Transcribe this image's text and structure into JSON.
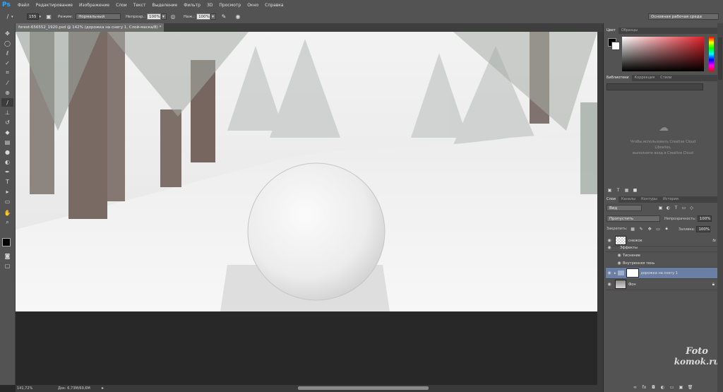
{
  "app": {
    "logo": "Ps"
  },
  "menu": [
    "Файл",
    "Редактирование",
    "Изображение",
    "Слои",
    "Текст",
    "Выделение",
    "Фильтр",
    "3D",
    "Просмотр",
    "Окно",
    "Справка"
  ],
  "options": {
    "size": "155",
    "mode_label": "Режим:",
    "mode_value": "Нормальный",
    "opacity_label": "Непрозр.:",
    "opacity_value": "100%",
    "pressure_label": "Наж.:",
    "pressure_value": "100%",
    "workspace": "Основная рабочая среда"
  },
  "document": {
    "tab_title": "forest-656552_1920.psd @ 142% (дорожка на снегу 1, Слой-маска/8) *",
    "zoom": "141,72%",
    "doc_size": "Док: 6,73M/69,6M"
  },
  "tools": [
    "move-icon",
    "marquee-icon",
    "lasso-icon",
    "quick-select-icon",
    "crop-icon",
    "eyedropper-icon",
    "heal-icon",
    "brush-icon",
    "stamp-icon",
    "history-brush-icon",
    "eraser-icon",
    "gradient-icon",
    "blur-icon",
    "dodge-icon",
    "pen-icon",
    "type-icon",
    "path-select-icon",
    "shape-icon",
    "hand-icon",
    "zoom-icon"
  ],
  "color_panel": {
    "tabs": [
      "Цвет",
      "Образцы"
    ]
  },
  "libraries_panel": {
    "tabs": [
      "Библиотеки",
      "Коррекция",
      "Стили"
    ],
    "message_line1": "Чтобы использовать Creative Cloud",
    "message_line2": "Libraries,",
    "message_line3": "выполните вход в Creative Cloud"
  },
  "layers_panel": {
    "tabs": [
      "Слои",
      "Каналы",
      "Контуры",
      "История"
    ],
    "kind_filter": "Вид",
    "blend_mode": "Пропустить",
    "opacity_label": "Непрозрачность:",
    "opacity_value": "100%",
    "lock_label": "Закрепить:",
    "fill_label": "Заливка:",
    "fill_value": "100%",
    "layers": [
      {
        "name": "снежок",
        "fx": "fx"
      },
      {
        "name": "Эффекты"
      },
      {
        "name": "Тиснение"
      },
      {
        "name": "Внутренняя тень"
      },
      {
        "name": "дорожка на снегу 1"
      },
      {
        "name": "Фон"
      }
    ]
  },
  "watermark": {
    "line1": "Foto",
    "line2": "komok.ru"
  },
  "colors": {
    "accent": "#31a8ff",
    "panel": "#535353",
    "selected_layer": "#6a7fa3"
  }
}
